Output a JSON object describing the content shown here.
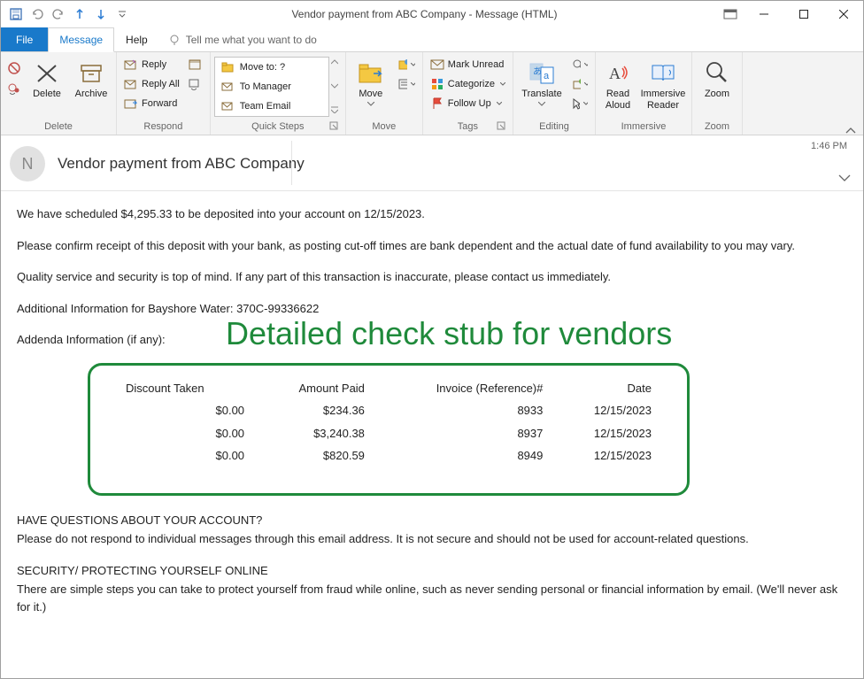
{
  "window": {
    "title": "Vendor payment from ABC Company  -  Message (HTML)"
  },
  "tabs": {
    "file": "File",
    "message": "Message",
    "help": "Help",
    "tell_me": "Tell me what you want to do"
  },
  "ribbon": {
    "delete_group": "Delete",
    "delete": "Delete",
    "archive": "Archive",
    "respond_group": "Respond",
    "reply": "Reply",
    "reply_all": "Reply All",
    "forward": "Forward",
    "quick_steps_group": "Quick Steps",
    "qs_move_to": "Move to: ?",
    "qs_to_manager": "To Manager",
    "qs_team_email": "Team Email",
    "move_group": "Move",
    "move": "Move",
    "tags_group": "Tags",
    "mark_unread": "Mark Unread",
    "categorize": "Categorize",
    "follow_up": "Follow Up",
    "editing_group": "Editing",
    "translate": "Translate",
    "immersive_group": "Immersive",
    "read_aloud": "Read\nAloud",
    "immersive_reader": "Immersive\nReader",
    "zoom_group": "Zoom",
    "zoom": "Zoom"
  },
  "header": {
    "avatar_initial": "N",
    "subject": "Vendor payment from ABC Company",
    "timestamp": "1:46 PM"
  },
  "body": {
    "p1": "We have scheduled $4,295.33 to be deposited into your account on 12/15/2023.",
    "p2": "Please confirm receipt of this deposit with your bank, as posting cut-off times are bank dependent and the actual date of fund availability to you may vary.",
    "p3": "Quality service and security is top of mind. If any part of this transaction is inaccurate, please contact us immediately.",
    "p4": "Additional Information for Bayshore Water: 370C-99336622",
    "p5": "Addenda Information (if any):",
    "annotation": "Detailed check stub for vendors",
    "stub": {
      "headers": [
        "Discount Taken",
        "Amount Paid",
        "Invoice (Reference)#",
        "Date"
      ],
      "rows": [
        {
          "discount": "$0.00",
          "amount": "$234.36",
          "invoice": "8933",
          "date": "12/15/2023"
        },
        {
          "discount": "$0.00",
          "amount": "$3,240.38",
          "invoice": "8937",
          "date": "12/15/2023"
        },
        {
          "discount": "$0.00",
          "amount": "$820.59",
          "invoice": "8949",
          "date": "12/15/2023"
        }
      ]
    },
    "q_title": "HAVE QUESTIONS ABOUT YOUR ACCOUNT?",
    "q_text": "Please do not respond to individual messages through this email address. It is not secure and should not be used for account-related questions.",
    "s_title": "SECURITY/ PROTECTING YOURSELF ONLINE",
    "s_text": "There are simple steps you can take to protect yourself from fraud while online, such as never sending personal or financial information by email. (We'll never ask for it.)"
  }
}
